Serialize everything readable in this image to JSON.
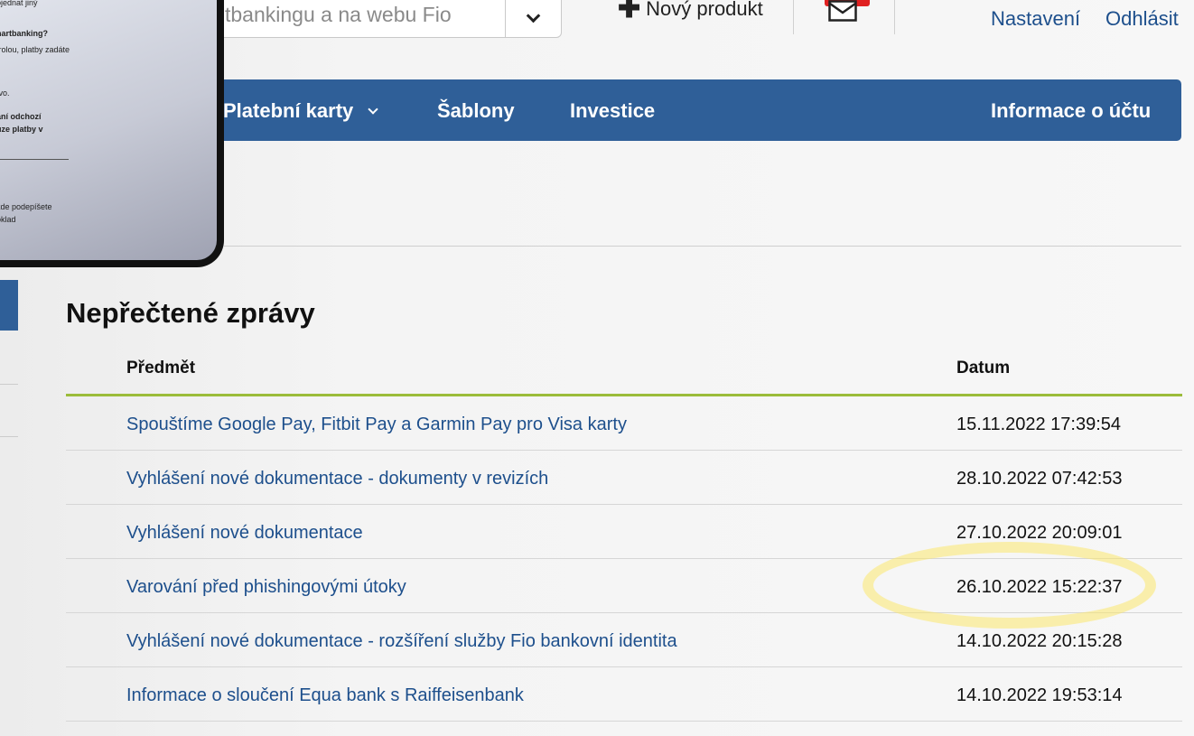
{
  "header": {
    "search_text": "tbankingu a na webu Fio",
    "new_product_label": "Nový produkt",
    "settings_label": "Nastavení",
    "logout_label": "Odhlásit"
  },
  "nav": {
    "items": [
      {
        "label": "Platební karty",
        "dropdown": true
      },
      {
        "label": "Šablony"
      },
      {
        "label": "Investice"
      },
      {
        "label": "Informace o účtu"
      }
    ]
  },
  "phone": {
    "lines": [
      "ojednat jiný",
      "nartbanking?",
      "trolou, platby zadáte",
      "tvo.",
      "aní odchozí",
      "uze platby v",
      "kde podepíšete",
      "oklad"
    ]
  },
  "messages": {
    "title": "Nepřečtené zprávy",
    "col_subject": "Předmět",
    "col_date": "Datum",
    "rows": [
      {
        "subject": "Spouštíme Google Pay, Fitbit Pay a Garmin Pay pro Visa karty",
        "date": "15.11.2022 17:39:54"
      },
      {
        "subject": "Vyhlášení nové dokumentace - dokumenty v revizích",
        "date": "28.10.2022 07:42:53"
      },
      {
        "subject": "Vyhlášení nové dokumentace",
        "date": "27.10.2022 20:09:01"
      },
      {
        "subject": "Varování před phishingovými útoky",
        "date": "26.10.2022 15:22:37"
      },
      {
        "subject": "Vyhlášení nové dokumentace - rozšíření služby Fio bankovní identita",
        "date": "14.10.2022 20:15:28"
      },
      {
        "subject": "Informace o sloučení Equa bank s Raiffeisenbank",
        "date": "14.10.2022 19:53:14"
      }
    ]
  },
  "colors": {
    "nav_bg": "#2f5f98",
    "link": "#1d4f8c",
    "header_rule": "#9bbc3a",
    "highlight": "#fce86e",
    "badge": "#e02020"
  }
}
